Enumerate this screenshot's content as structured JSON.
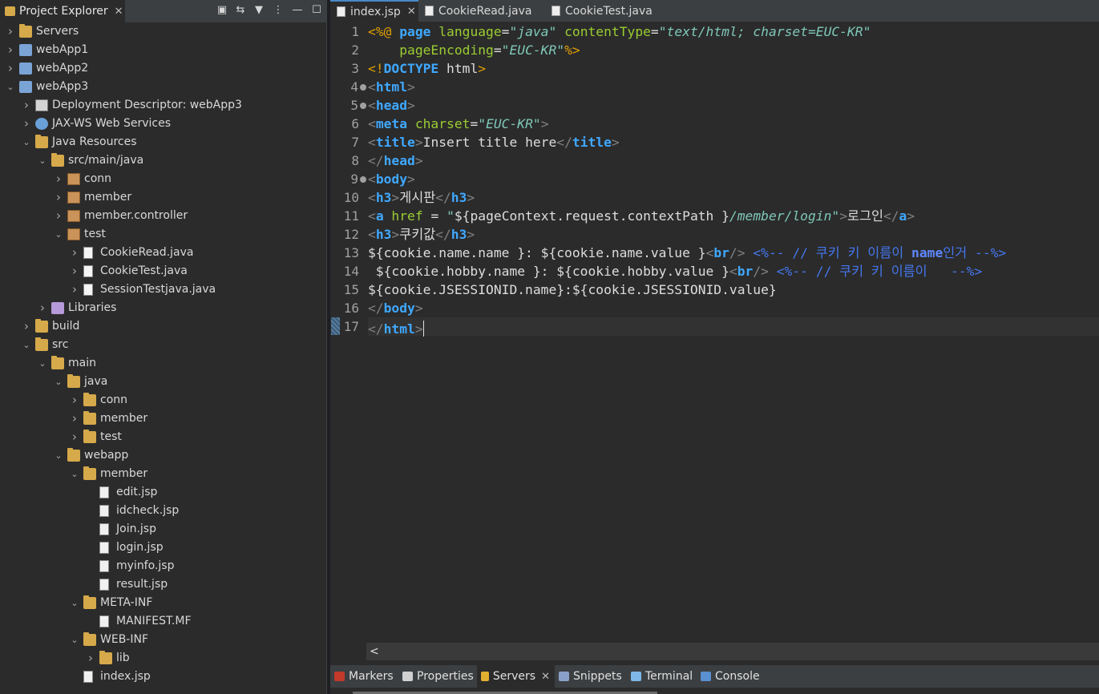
{
  "explorer": {
    "title": "Project Explorer",
    "toolbar": [
      {
        "name": "collapse-all-icon",
        "glyph": "▣"
      },
      {
        "name": "link-with-editor-icon",
        "glyph": "⇆"
      },
      {
        "name": "filter-icon",
        "glyph": "▼"
      },
      {
        "name": "view-menu-icon",
        "glyph": "⋮"
      },
      {
        "name": "minimize-icon",
        "glyph": "—"
      },
      {
        "name": "maximize-icon",
        "glyph": "☐"
      }
    ],
    "tree": [
      {
        "label": "Servers",
        "depth": 0,
        "expanded": false,
        "icon": "folder"
      },
      {
        "label": "webApp1",
        "depth": 0,
        "expanded": false,
        "icon": "project"
      },
      {
        "label": "webApp2",
        "depth": 0,
        "expanded": false,
        "icon": "project"
      },
      {
        "label": "webApp3",
        "depth": 0,
        "expanded": true,
        "icon": "project"
      },
      {
        "label": "Deployment Descriptor: webApp3",
        "depth": 1,
        "expanded": false,
        "icon": "desc"
      },
      {
        "label": "JAX-WS Web Services",
        "depth": 1,
        "expanded": false,
        "icon": "ws"
      },
      {
        "label": "Java Resources",
        "depth": 1,
        "expanded": true,
        "icon": "folder"
      },
      {
        "label": "src/main/java",
        "depth": 2,
        "expanded": true,
        "icon": "folder"
      },
      {
        "label": "conn",
        "depth": 3,
        "expanded": false,
        "icon": "package"
      },
      {
        "label": "member",
        "depth": 3,
        "expanded": false,
        "icon": "package"
      },
      {
        "label": "member.controller",
        "depth": 3,
        "expanded": false,
        "icon": "package"
      },
      {
        "label": "test",
        "depth": 3,
        "expanded": true,
        "icon": "package"
      },
      {
        "label": "CookieRead.java",
        "depth": 4,
        "expanded": false,
        "icon": "java"
      },
      {
        "label": "CookieTest.java",
        "depth": 4,
        "expanded": false,
        "icon": "java"
      },
      {
        "label": "SessionTestjava.java",
        "depth": 4,
        "expanded": false,
        "icon": "java"
      },
      {
        "label": "Libraries",
        "depth": 2,
        "expanded": false,
        "icon": "lib"
      },
      {
        "label": "build",
        "depth": 1,
        "expanded": false,
        "icon": "folder"
      },
      {
        "label": "src",
        "depth": 1,
        "expanded": true,
        "icon": "folder"
      },
      {
        "label": "main",
        "depth": 2,
        "expanded": true,
        "icon": "folder"
      },
      {
        "label": "java",
        "depth": 3,
        "expanded": true,
        "icon": "folder"
      },
      {
        "label": "conn",
        "depth": 4,
        "expanded": false,
        "icon": "folder"
      },
      {
        "label": "member",
        "depth": 4,
        "expanded": false,
        "icon": "folder"
      },
      {
        "label": "test",
        "depth": 4,
        "expanded": false,
        "icon": "folder"
      },
      {
        "label": "webapp",
        "depth": 3,
        "expanded": true,
        "icon": "folder"
      },
      {
        "label": "member",
        "depth": 4,
        "expanded": true,
        "icon": "folder"
      },
      {
        "label": "edit.jsp",
        "depth": 5,
        "icon": "file"
      },
      {
        "label": "idcheck.jsp",
        "depth": 5,
        "icon": "file"
      },
      {
        "label": "Join.jsp",
        "depth": 5,
        "icon": "file"
      },
      {
        "label": "login.jsp",
        "depth": 5,
        "icon": "file"
      },
      {
        "label": "myinfo.jsp",
        "depth": 5,
        "icon": "file"
      },
      {
        "label": "result.jsp",
        "depth": 5,
        "icon": "file"
      },
      {
        "label": "META-INF",
        "depth": 4,
        "expanded": true,
        "icon": "folder"
      },
      {
        "label": "MANIFEST.MF",
        "depth": 5,
        "icon": "file"
      },
      {
        "label": "WEB-INF",
        "depth": 4,
        "expanded": true,
        "icon": "folder"
      },
      {
        "label": "lib",
        "depth": 5,
        "expanded": false,
        "icon": "folder"
      },
      {
        "label": "index.jsp",
        "depth": 4,
        "icon": "file"
      }
    ]
  },
  "editor": {
    "tabs": [
      {
        "label": "index.jsp",
        "active": true,
        "closable": true
      },
      {
        "label": "CookieRead.java",
        "active": false,
        "closable": false
      },
      {
        "label": "CookieTest.java",
        "active": false,
        "closable": false
      }
    ],
    "current_line": 17,
    "folds": [
      4,
      5,
      9
    ],
    "lines": [
      [
        [
          "dlm",
          "<%@ "
        ],
        [
          "kw",
          "page "
        ],
        [
          "attr",
          "language"
        ],
        [
          "el",
          "="
        ],
        [
          "str",
          "\"java\" "
        ],
        [
          "attr",
          "contentType"
        ],
        [
          "el",
          "="
        ],
        [
          "str",
          "\"text/html; charset=EUC-KR\""
        ]
      ],
      [
        [
          "el",
          "    "
        ],
        [
          "attr",
          "pageEncoding"
        ],
        [
          "el",
          "="
        ],
        [
          "str",
          "\"EUC-KR\""
        ],
        [
          "dlm",
          "%>"
        ]
      ],
      [
        [
          "dlm",
          "<!"
        ],
        [
          "kw",
          "DOCTYPE "
        ],
        [
          "txt",
          "html"
        ],
        [
          "dlm",
          ">"
        ]
      ],
      [
        [
          "br",
          "<"
        ],
        [
          "tag",
          "html"
        ],
        [
          "br",
          ">"
        ]
      ],
      [
        [
          "br",
          "<"
        ],
        [
          "tag",
          "head"
        ],
        [
          "br",
          ">"
        ]
      ],
      [
        [
          "br",
          "<"
        ],
        [
          "tag",
          "meta "
        ],
        [
          "attr",
          "charset"
        ],
        [
          "el",
          "="
        ],
        [
          "str",
          "\"EUC-KR\""
        ],
        [
          "br",
          ">"
        ]
      ],
      [
        [
          "br",
          "<"
        ],
        [
          "tag",
          "title"
        ],
        [
          "br",
          ">"
        ],
        [
          "txt",
          "Insert title here"
        ],
        [
          "br",
          "</"
        ],
        [
          "tag",
          "title"
        ],
        [
          "br",
          ">"
        ]
      ],
      [
        [
          "br",
          "</"
        ],
        [
          "tag",
          "head"
        ],
        [
          "br",
          ">"
        ]
      ],
      [
        [
          "br",
          "<"
        ],
        [
          "tag",
          "body"
        ],
        [
          "br",
          ">"
        ]
      ],
      [
        [
          "br",
          "<"
        ],
        [
          "tag",
          "h3"
        ],
        [
          "br",
          ">"
        ],
        [
          "txt",
          "게시판"
        ],
        [
          "br",
          "</"
        ],
        [
          "tag",
          "h3"
        ],
        [
          "br",
          ">"
        ]
      ],
      [
        [
          "br",
          "<"
        ],
        [
          "tag",
          "a "
        ],
        [
          "attr",
          "href"
        ],
        [
          "el",
          " = "
        ],
        [
          "str",
          "\""
        ],
        [
          "txt",
          "${pageContext.request.contextPath }"
        ],
        [
          "str",
          "/member/login\""
        ],
        [
          "br",
          ">"
        ],
        [
          "txt",
          "로그인"
        ],
        [
          "br",
          "</"
        ],
        [
          "tag",
          "a"
        ],
        [
          "br",
          ">"
        ]
      ],
      [
        [
          "br",
          "<"
        ],
        [
          "tag",
          "h3"
        ],
        [
          "br",
          ">"
        ],
        [
          "txt",
          "쿠키값"
        ],
        [
          "br",
          "</"
        ],
        [
          "tag",
          "h3"
        ],
        [
          "br",
          ">"
        ]
      ],
      [
        [
          "txt",
          "${cookie.name.name }: ${cookie.name.value }"
        ],
        [
          "br",
          "<"
        ],
        [
          "tag",
          "br"
        ],
        [
          "br",
          "/> "
        ],
        [
          "cmt",
          "<%-- // 쿠키 키 이름이 "
        ],
        [
          "cmtkw",
          "name"
        ],
        [
          "cmt",
          "인거 --%>"
        ]
      ],
      [
        [
          "txt",
          " ${cookie.hobby.name }: ${cookie.hobby.value }"
        ],
        [
          "br",
          "<"
        ],
        [
          "tag",
          "br"
        ],
        [
          "br",
          "/> "
        ],
        [
          "cmt",
          "<%-- // 쿠키 키 이름이   --%>"
        ]
      ],
      [
        [
          "txt",
          "${cookie.JSESSIONID.name}:${cookie.JSESSIONID.value}"
        ]
      ],
      [
        [
          "br",
          "</"
        ],
        [
          "tag",
          "body"
        ],
        [
          "br",
          ">"
        ]
      ],
      [
        [
          "br",
          "</"
        ],
        [
          "tag",
          "html"
        ],
        [
          "br",
          ">"
        ]
      ]
    ],
    "hscroll_left": "<"
  },
  "bottom": {
    "tabs": [
      {
        "label": "Markers",
        "icon": "markers-icon",
        "color": "#c0392b",
        "active": false,
        "closable": false
      },
      {
        "label": "Properties",
        "icon": "properties-icon",
        "color": "#d0d0d0",
        "active": false,
        "closable": false
      },
      {
        "label": "Servers",
        "icon": "servers-icon",
        "color": "#e0b030",
        "active": true,
        "closable": true
      },
      {
        "label": "Snippets",
        "icon": "snippets-icon",
        "color": "#8aa0c8",
        "active": false,
        "closable": false
      },
      {
        "label": "Terminal",
        "icon": "terminal-icon",
        "color": "#7fb8e8",
        "active": false,
        "closable": false
      },
      {
        "label": "Console",
        "icon": "console-icon",
        "color": "#5a8fd0",
        "active": false,
        "closable": false
      }
    ]
  },
  "colors": {
    "panel_bg": "#2b2b2b",
    "tab_bar_bg": "#3c3f41",
    "keyword": "#3fa8ff",
    "string": "#7fc8b8",
    "attribute": "#9acd32",
    "jsp_delimiter": "#e0a000",
    "comment": "#4477ee"
  }
}
